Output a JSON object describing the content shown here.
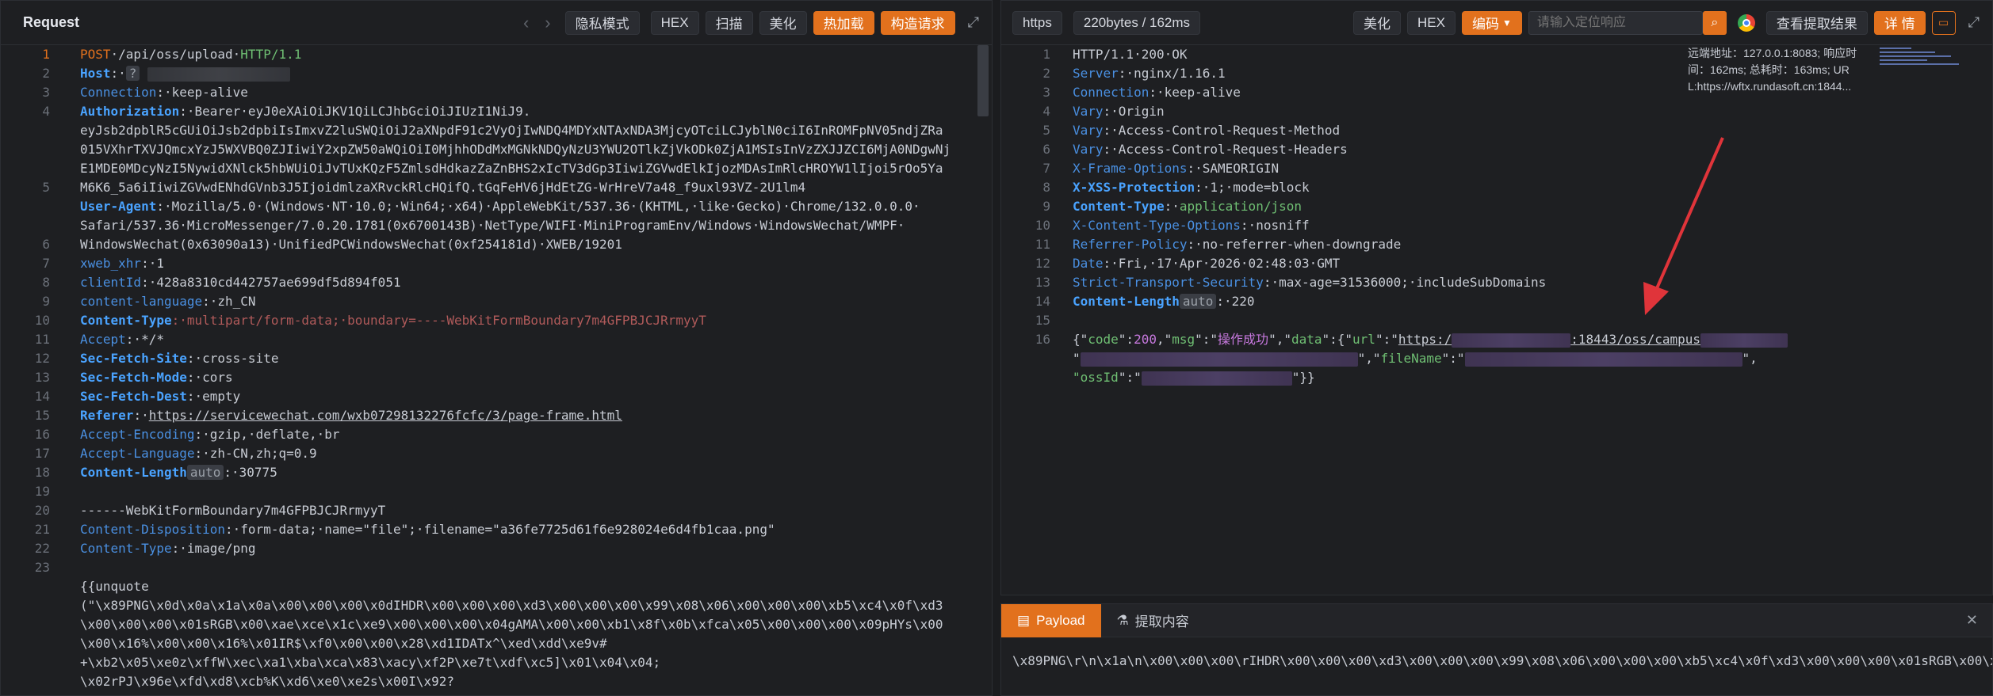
{
  "request": {
    "title": "Request",
    "buttons": {
      "privacy": "隐私模式",
      "hex": "HEX",
      "scan": "扫描",
      "beautify": "美化",
      "hotload": "热加载",
      "build": "构造请求"
    },
    "lines": [
      {
        "n": "1"
      },
      {
        "n": "2"
      },
      {
        "n": "3"
      },
      {
        "n": "4"
      },
      {
        "n": ""
      },
      {
        "n": ""
      },
      {
        "n": ""
      },
      {
        "n": "5"
      },
      {
        "n": ""
      },
      {
        "n": ""
      },
      {
        "n": "6"
      },
      {
        "n": "7"
      },
      {
        "n": "8"
      },
      {
        "n": "9"
      },
      {
        "n": "10"
      },
      {
        "n": "11"
      },
      {
        "n": "12"
      },
      {
        "n": "13"
      },
      {
        "n": "14"
      },
      {
        "n": "15"
      },
      {
        "n": "16"
      },
      {
        "n": "17"
      },
      {
        "n": "18"
      },
      {
        "n": "19"
      },
      {
        "n": "20"
      },
      {
        "n": "21"
      },
      {
        "n": "22"
      },
      {
        "n": "23"
      },
      {
        "n": ""
      },
      {
        "n": ""
      },
      {
        "n": ""
      },
      {
        "n": ""
      },
      {
        "n": ""
      }
    ],
    "line1": {
      "method": "POST",
      "path": "·/api/oss/upload·",
      "version": "HTTP/1.1"
    },
    "host": {
      "key": "Host",
      "sep": ":·",
      "q": "?"
    },
    "connection": {
      "key": "Connection",
      "val": ":·keep-alive"
    },
    "auth": {
      "key": "Authorization",
      "val": ":·Bearer·eyJ0eXAiOiJKV1QiLCJhbGciOiJIUzI1NiJ9."
    },
    "auth2": "eyJsb2dpblR5cGUiOiJsb2dpbiIsImxvZ2luSWQiOiJ2aXNpdF91c2VyOjIwNDQ4MDYxNTAxNDA3MjcyOTciLCJyblN0ciI6InROMFpNV05ndjZRa",
    "auth3": "015VXhrTXVJQmcxYzJ5WXVBQ0ZJIiwiY2xpZW50aWQiOiI0MjhhODdMxMGNkNDQyNzU3YWU2OTlkZjVkODk0ZjA1MSIsInVzZXJJZCI6MjA0NDgwNj",
    "auth4": "E1MDE0MDcyNzI5NywidXNlck5hbWUiOiJvTUxKQzF5ZmlsdHdkazZaZnBHS2xIcTV3dGp3IiwiZGVwdElkIjozMDAsImRlcHROYW1lIjoi5rOo5Ya",
    "auth5": "M6K6_5a6iIiwiZGVwdENhdGVnb3J5IjoidmlzaXRvckRlcHQifQ.tGqFeHV6jHdEtZG-WrHreV7a48_f9uxl93VZ-2U1lm4",
    "ua": {
      "key": "User-Agent",
      "val": ":·Mozilla/5.0·(Windows·NT·10.0;·Win64;·x64)·AppleWebKit/537.36·(KHTML,·like·Gecko)·Chrome/132.0.0.0·"
    },
    "ua2": "Safari/537.36·MicroMessenger/7.0.20.1781(0x6700143B)·NetType/WIFI·MiniProgramEnv/Windows·WindowsWechat/WMPF·",
    "ua3": "WindowsWechat(0x63090a13)·UnifiedPCWindowsWechat(0xf254181d)·XWEB/19201",
    "xweb": {
      "key": "xweb_xhr",
      "val": ":·1"
    },
    "clientid": {
      "key": "clientId",
      "val": ":·428a8310cd442757ae699df5d894f051"
    },
    "lang": {
      "key": "content-language",
      "val": ":·zh_CN"
    },
    "ctype": {
      "key": "Content-Type",
      "val": ":·multipart/form-data;·boundary=----WebKitFormBoundary7m4GFPBJCJRrmyyT"
    },
    "accept": {
      "key": "Accept",
      "val": ":·*/*"
    },
    "fsite": {
      "key": "Sec-Fetch-Site",
      "val": ":·cross-site"
    },
    "fmode": {
      "key": "Sec-Fetch-Mode",
      "val": ":·cors"
    },
    "fdest": {
      "key": "Sec-Fetch-Dest",
      "val": ":·empty"
    },
    "referer": {
      "key": "Referer",
      "sep": ":·",
      "url": "https://servicewechat.com/wxb07298132276fcfc/3/page-frame.html"
    },
    "aenc": {
      "key": "Accept-Encoding",
      "val": ":·gzip,·deflate,·br"
    },
    "alang": {
      "key": "Accept-Language",
      "val": ":·zh-CN,zh;q=0.9"
    },
    "clen": {
      "key": "Content-Length",
      "tag": "auto",
      "val": ":·30775"
    },
    "boundary": "------WebKitFormBoundary7m4GFPBJCJRrmyyT",
    "cdisp": {
      "key": "Content-Disposition",
      "val": ":·form-data;·name=\"file\";·filename=\"a36fe7725d61f6e928024e6d4fb1caa.png\""
    },
    "ctype2": {
      "key": "Content-Type",
      "val": ":·image/png"
    },
    "body1": "{{unquote",
    "body2": "(\"\\x89PNG\\x0d\\x0a\\x1a\\x0a\\x00\\x00\\x00\\x0dIHDR\\x00\\x00\\x00\\xd3\\x00\\x00\\x00\\x99\\x08\\x06\\x00\\x00\\x00\\xb5\\xc4\\x0f\\xd3",
    "body3": "\\x00\\x00\\x00\\x01sRGB\\x00\\xae\\xce\\x1c\\xe9\\x00\\x00\\x00\\x04gAMA\\x00\\x00\\xb1\\x8f\\x0b\\xfca\\x05\\x00\\x00\\x00\\x09pHYs\\x00",
    "body4": "\\x00\\x16%\\x00\\x00\\x16%\\x01IR$\\xf0\\x00\\x00\\x28\\xd1IDATx^\\xed\\xdd\\xe9v#",
    "body5": "+\\xb2\\x05\\xe0z\\xffW\\xec\\xa1\\xba\\xca\\x83\\xacy\\xf2P\\xe7t\\xdf\\xc5]\\x01\\x04\\x04;",
    "body6": "\\x02rPJ\\x96e\\xfd\\xd8\\xcb%K\\xd6\\xe0\\xe2s\\x00I\\x92?"
  },
  "response": {
    "scheme": "https",
    "size": "220bytes / 162ms",
    "buttons": {
      "beautify": "美化",
      "hex": "HEX",
      "encode": "编码",
      "view": "查看提取结果",
      "detail": "详 情"
    },
    "search_placeholder": "请输入定位响应",
    "remote": {
      "l1": "远端地址：127.0.0.1:8083; 响应时",
      "l2": "间：162ms; 总耗时：163ms; UR",
      "l3": "L:https://wftx.rundasoft.cn:1844..."
    },
    "lines": [
      "1",
      "2",
      "3",
      "4",
      "5",
      "6",
      "7",
      "8",
      "9",
      "10",
      "11",
      "12",
      "13",
      "14",
      "15",
      "16",
      "",
      ""
    ],
    "status": "HTTP/1.1·200·OK",
    "h": [
      {
        "k": "Server",
        "v": ":·nginx/1.16.1"
      },
      {
        "k": "Connection",
        "v": ":·keep-alive"
      },
      {
        "k": "Vary",
        "v": ":·Origin"
      },
      {
        "k": "Vary",
        "v": ":·Access-Control-Request-Method"
      },
      {
        "k": "Vary",
        "v": ":·Access-Control-Request-Headers"
      },
      {
        "k": "X-Frame-Options",
        "v": ":·SAMEORIGIN"
      },
      {
        "k": "X-XSS-Protection",
        "v": ":·1;·mode=block"
      },
      {
        "k": "Content-Type",
        "v": ":·",
        "v2": "application/json"
      },
      {
        "k": "X-Content-Type-Options",
        "v": ":·nosniff"
      },
      {
        "k": "Referrer-Policy",
        "v": ":·no-referrer-when-downgrade"
      },
      {
        "k": "Date",
        "v": ":·Fri,·17·Apr·2026·02:48:03·GMT"
      },
      {
        "k": "Strict-Transport-Security",
        "v": ":·max-age=31536000;·includeSubDomains"
      },
      {
        "k": "Content-Length",
        "tag": "auto",
        "v": ":·220"
      }
    ],
    "json": {
      "p1": "{\"",
      "code_k": "code",
      "p2": "\":",
      "code_v": "200",
      "p3": ",\"",
      "msg_k": "msg",
      "p4": "\":\"",
      "msg_v": "操作成功",
      "p5": "\",\"",
      "data_k": "data",
      "p6": "\":{\"",
      "url_k": "url",
      "p7": "\":\"",
      "url_v1": "https:/",
      "url_v2": ":18443/oss/campus",
      "l2a": "\"",
      "fn_p": "\",\"",
      "fn_k": "fileName",
      "fn_p2": "\":\"",
      "end2": "\",",
      "os_k": "ossId",
      "os_p": "\":\"",
      "end3": "\"}}"
    }
  },
  "payload": {
    "tab1": "Payload",
    "tab2": "提取内容",
    "content": "\\x89PNG\\r\\n\\x1a\\n\\x00\\x00\\x00\\rIHDR\\x00\\x00\\x00\\xd3\\x00\\x00\\x00\\x99\\x08\\x06\\x00\\x00\\x00\\xb5\\xc4\\x0f\\xd3\\x00\\x00\\x00\\x01sRGB\\x00\\xae\\xce\\x1c\\x"
  }
}
